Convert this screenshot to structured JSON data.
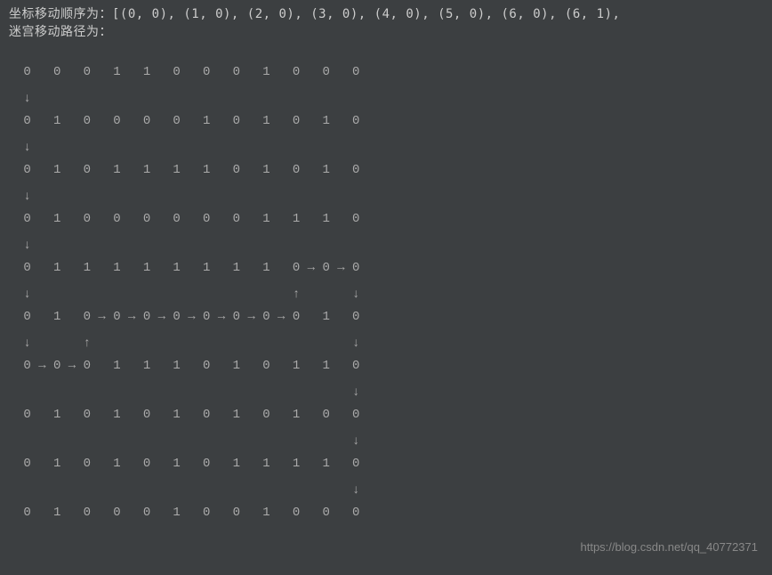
{
  "header": {
    "line1": "坐标移动顺序为：[(0, 0), (1, 0), (2, 0), (3, 0), (4, 0), (5, 0), (6, 0), (6, 1),",
    "line2": "迷宫移动路径为："
  },
  "maze": {
    "rows": [
      " 0   0   0   1   1   0   0   0   1   0   0   0",
      " ↓",
      " 0   1   0   0   0   0   1   0   1   0   1   0",
      " ↓",
      " 0   1   0   1   1   1   1   0   1   0   1   0",
      " ↓",
      " 0   1   0   0   0   0   0   0   1   1   1   0",
      " ↓",
      " 0   1   1   1   1   1   1   1   1   0 → 0 → 0",
      " ↓                                   ↑       ↓",
      " 0   1   0 → 0 → 0 → 0 → 0 → 0 → 0 → 0   1   0",
      " ↓       ↑                                   ↓",
      " 0 → 0 → 0   1   1   1   0   1   0   1   1   0",
      "                                             ↓",
      " 0   1   0   1   0   1   0   1   0   1   0   0",
      "                                             ↓",
      " 0   1   0   1   0   1   0   1   1   1   1   0",
      "                                             ↓",
      " 0   1   0   0   0   1   0   0   1   0   0   0"
    ]
  },
  "watermark": "https://blog.csdn.net/qq_40772371",
  "chart_data": {
    "type": "table",
    "title": "迷宫及移动路径",
    "grid": [
      [
        0,
        0,
        0,
        1,
        1,
        0,
        0,
        0,
        1,
        0,
        0,
        0
      ],
      [
        0,
        1,
        0,
        0,
        0,
        0,
        1,
        0,
        1,
        0,
        1,
        0
      ],
      [
        0,
        1,
        0,
        1,
        1,
        1,
        1,
        0,
        1,
        0,
        1,
        0
      ],
      [
        0,
        1,
        0,
        0,
        0,
        0,
        0,
        0,
        1,
        1,
        1,
        0
      ],
      [
        0,
        1,
        1,
        1,
        1,
        1,
        1,
        1,
        1,
        0,
        0,
        0
      ],
      [
        0,
        1,
        0,
        0,
        0,
        0,
        0,
        0,
        0,
        0,
        1,
        0
      ],
      [
        0,
        0,
        0,
        1,
        1,
        1,
        0,
        1,
        0,
        1,
        1,
        0
      ],
      [
        0,
        1,
        0,
        1,
        0,
        1,
        0,
        1,
        0,
        1,
        0,
        0
      ],
      [
        0,
        1,
        0,
        1,
        0,
        1,
        0,
        1,
        1,
        1,
        1,
        0
      ],
      [
        0,
        1,
        0,
        0,
        0,
        1,
        0,
        0,
        1,
        0,
        0,
        0
      ]
    ],
    "path_start": [
      0,
      0
    ],
    "coord_sequence_visible": "[(0, 0), (1, 0), (2, 0), (3, 0), (4, 0), (5, 0), (6, 0), (6, 1),"
  }
}
